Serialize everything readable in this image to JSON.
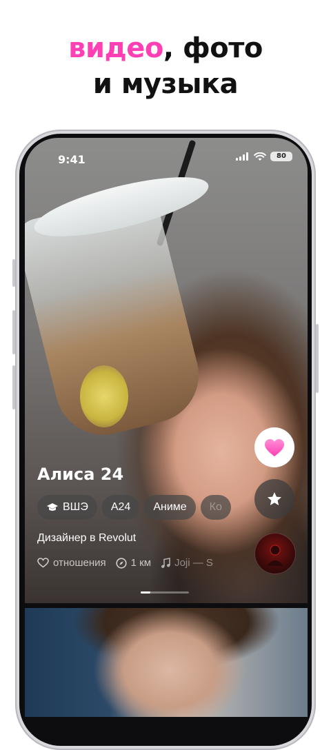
{
  "headline": {
    "accent": "видео",
    "line1_rest": ", фото",
    "line2": "и музыка"
  },
  "status_bar": {
    "time": "9:41",
    "battery": "80"
  },
  "profile": {
    "name": "Алиса 24",
    "tags": [
      {
        "label": "ВШЭ",
        "icon": "graduation-cap-icon"
      },
      {
        "label": "A24"
      },
      {
        "label": "Аниме"
      },
      {
        "label": "Ко"
      }
    ],
    "job": "Дизайнер в Revolut",
    "meta": {
      "relationship": "отношения",
      "distance": "1 км",
      "music": "Joji — S"
    }
  },
  "colors": {
    "accent": "#ff3fb4",
    "like_heart": "#ff5cc0"
  }
}
